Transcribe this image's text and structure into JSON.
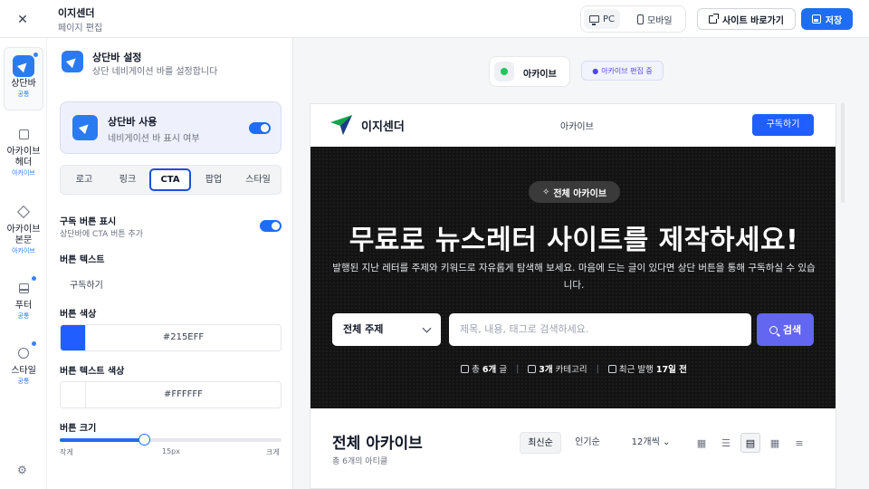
{
  "topbar": {
    "close_icon": "close-icon",
    "title": "이지센더",
    "subtitle": "페이지 편집",
    "device_pc": "PC",
    "device_mobile": "모바일",
    "site_link": "사이트 바로가기",
    "save": "저장",
    "accent_color": "#1d6ef5"
  },
  "rail": {
    "items": [
      {
        "label": "상단바",
        "sub": "공통",
        "icon": "navigation-icon",
        "active": true
      },
      {
        "label": "아카이브 헤더",
        "sub": "아카이브",
        "icon": "header-icon"
      },
      {
        "label": "아카이브 본문",
        "sub": "아카이브",
        "icon": "layers-icon"
      },
      {
        "label": "푸터",
        "sub": "공통",
        "icon": "footer-icon"
      },
      {
        "label": "스타일",
        "sub": "공통",
        "icon": "palette-icon"
      }
    ]
  },
  "panel": {
    "title": "상단바 설정",
    "desc": "상단 네비게이션 바를 설정합니다",
    "toggle_title": "상단바 사용",
    "toggle_desc": "네비게이션 바 표시 여부",
    "toggle_on": true,
    "tabs": [
      "로고",
      "링크",
      "CTA",
      "팝업",
      "스타일"
    ],
    "active_tab": "CTA",
    "subscribe_toggle_label": "구독 버튼 표시",
    "subscribe_toggle_desc": "상단바에 CTA 버튼 추가",
    "subscribe_toggle_on": true,
    "button_text_label": "버튼 텍스트",
    "button_text_value": "구독하기",
    "button_color_label": "버튼 색상",
    "button_color_value": "#215EFF",
    "button_text_color_label": "버튼 텍스트 색상",
    "button_text_color_value": "#FFFFFF",
    "button_size_label": "버튼 크기",
    "size_min": "작게",
    "size_value": "15px",
    "size_max": "크게",
    "size_fraction": 0.38
  },
  "preview": {
    "chip_label": "아카이브",
    "edit_badge": "아카이브 편집 중",
    "site": {
      "name": "이지센더",
      "nav": "아카이브",
      "cta": "구독하기",
      "hero_badge": "전체 아카이브",
      "hero_title": "무료로 뉴스레터 사이트를 제작하세요!",
      "hero_desc": "발행된 지난 레터를 주제와 키워드로 자유롭게 탐색해 보세요. 마음에 드는 글이 있다면 상단 버튼을 통해 구독하실 수 있습니다.",
      "topic_select": "전체 주제",
      "search_placeholder": "제목, 내용, 태그로 검색하세요.",
      "search_btn": "검색",
      "stat_posts_prefix": "총",
      "stat_posts": "6개",
      "stat_posts_suffix": "글",
      "stat_cats": "3개",
      "stat_cats_suffix": "카테고리",
      "stat_recent_prefix": "최근 발행",
      "stat_recent": "17일 전",
      "archive_title": "전체 아카이브",
      "archive_sub": "총 6개의 아티클",
      "sort_latest": "최신순",
      "sort_popular": "인기순",
      "per_page": "12개씩"
    }
  }
}
